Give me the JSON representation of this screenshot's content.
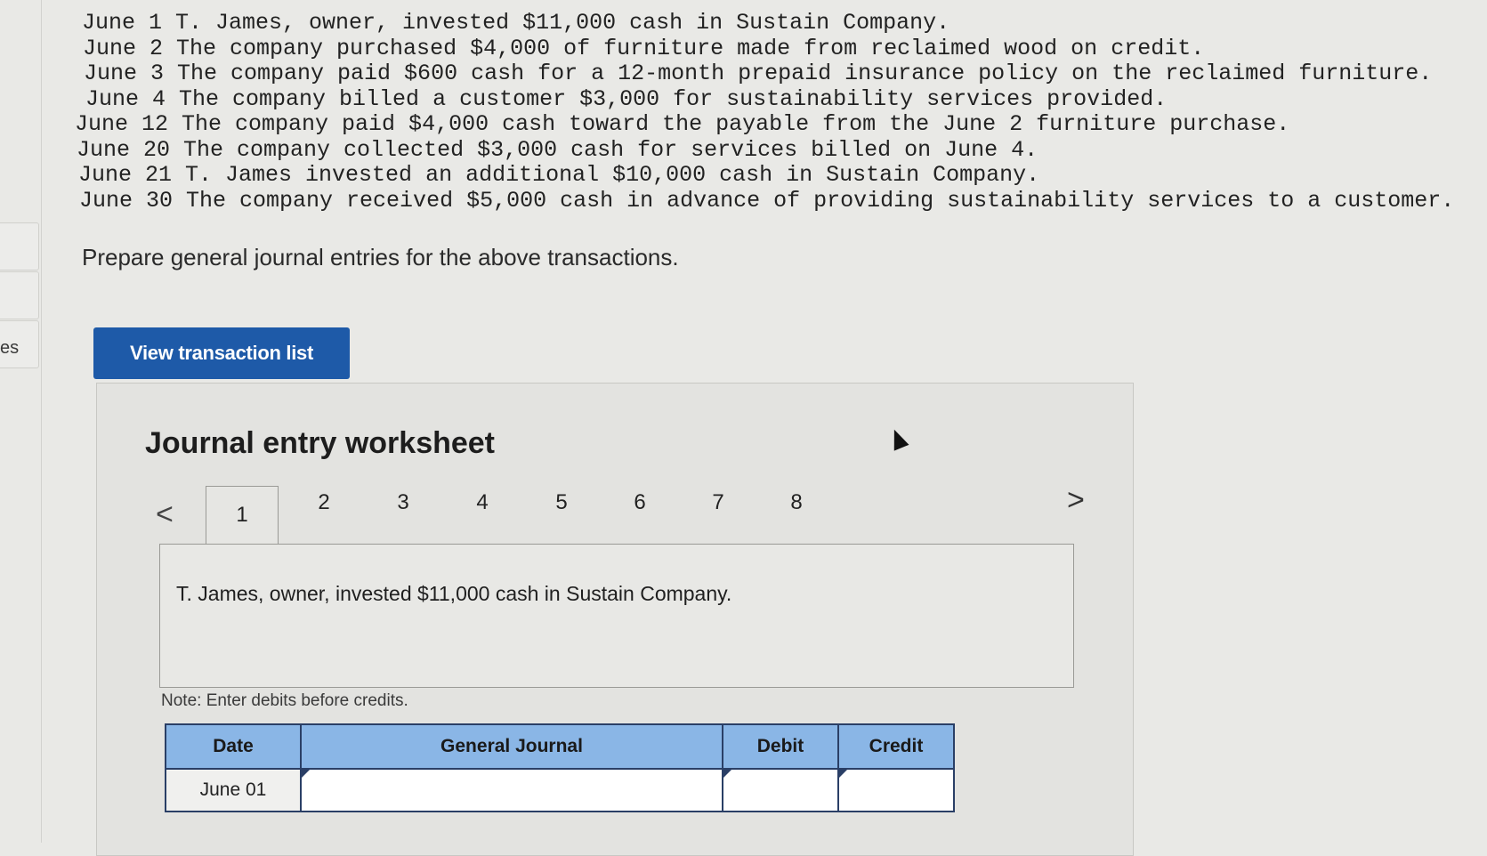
{
  "sidebar": {
    "cut_label": "es"
  },
  "transactions": [
    "June 1 T. James, owner, invested $11,000 cash in Sustain Company.",
    "June 2 The company purchased $4,000 of furniture made from reclaimed wood on credit.",
    "June 3 The company paid $600 cash for a 12-month prepaid insurance policy on the reclaimed furniture.",
    "June 4 The company billed a customer $3,000 for sustainability services provided.",
    "June 12 The company paid $4,000 cash toward the payable from the June 2 furniture purchase.",
    "June 20 The company collected $3,000 cash for services billed on June 4.",
    "June 21 T. James invested an additional $10,000 cash in Sustain Company.",
    "June 30 The company received $5,000 cash in advance of providing sustainability services to a customer."
  ],
  "instruction": "Prepare general journal entries for the above transactions.",
  "view_button_label": "View transaction list",
  "worksheet": {
    "title": "Journal entry worksheet",
    "prev_icon": "<",
    "next_icon": ">",
    "tabs": [
      "1",
      "2",
      "3",
      "4",
      "5",
      "6",
      "7",
      "8"
    ],
    "active_tab": "1",
    "description": "T. James, owner, invested $11,000 cash in Sustain Company.",
    "note": "Note: Enter debits before credits.",
    "table": {
      "headers": {
        "date": "Date",
        "journal": "General Journal",
        "debit": "Debit",
        "credit": "Credit"
      },
      "rows": [
        {
          "date": "June 01",
          "journal": "",
          "debit": "",
          "credit": ""
        }
      ]
    }
  }
}
